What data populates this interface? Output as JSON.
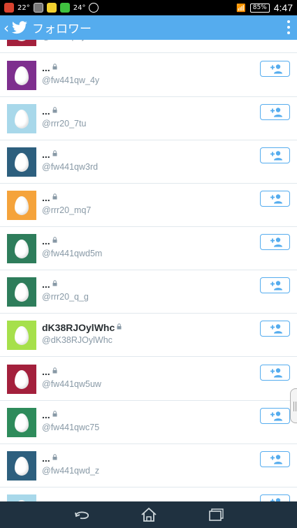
{
  "status_bar": {
    "left_icons": [
      "app-notification-icon",
      "image-icon",
      "game-icon",
      "line-icon",
      "e-icon"
    ],
    "temp1": "22°",
    "temp2": "24°",
    "battery": "85%",
    "time": "4:47"
  },
  "action_bar": {
    "title": "フォロワー",
    "color": "#55acee"
  },
  "follow_icon": "add-user-icon",
  "rows": [
    {
      "name": "",
      "handle": "@zrexxpoyH",
      "avatar_color": "#a3203c"
    },
    {
      "name": "...",
      "handle": "@fw441qw_4y",
      "avatar_color": "#7e2f8e"
    },
    {
      "name": "...",
      "handle": "@rrr20_7tu",
      "avatar_color": "#a8d8ea"
    },
    {
      "name": "...",
      "handle": "@fw441qw3rd",
      "avatar_color": "#2d5f7e"
    },
    {
      "name": "...",
      "handle": "@rrr20_mq7",
      "avatar_color": "#f5a33b"
    },
    {
      "name": "...",
      "handle": "@fw441qwd5m",
      "avatar_color": "#2e7d5b"
    },
    {
      "name": "...",
      "handle": "@rrr20_q_g",
      "avatar_color": "#2e7d5b"
    },
    {
      "name": "dK38RJOylWhc",
      "handle": "@dK38RJOylWhc",
      "avatar_color": "#a6e04b"
    },
    {
      "name": "...",
      "handle": "@fw441qw5uw",
      "avatar_color": "#a3203c"
    },
    {
      "name": "...",
      "handle": "@fw441qwc75",
      "avatar_color": "#2e8b5b"
    },
    {
      "name": "...",
      "handle": "@fw441qwd_z",
      "avatar_color": "#2d5f7e"
    },
    {
      "name": "",
      "handle": "",
      "avatar_color": "#a8d8ea"
    }
  ],
  "nav": {
    "back": "back-icon",
    "home": "home-icon",
    "recent": "recent-apps-icon"
  }
}
